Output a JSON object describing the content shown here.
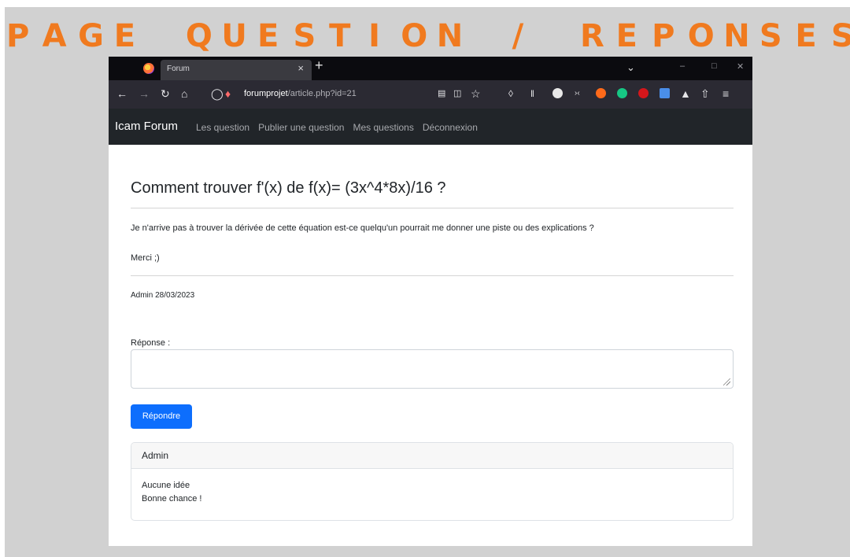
{
  "banner": {
    "letters": [
      "P",
      "A",
      "G",
      "E",
      "",
      "Q",
      "U",
      "E",
      "S",
      "T",
      "I",
      "O",
      "N",
      "",
      "/",
      "",
      "R",
      "E",
      "P",
      "O",
      "N",
      "S",
      "E",
      "S"
    ]
  },
  "browser": {
    "tab_title": "Forum",
    "tab_close": "×",
    "new_tab": "+",
    "url_host": "forumprojet",
    "url_path": "/article.php?id=21",
    "icons": {
      "back": "back-arrow-icon",
      "forward": "forward-arrow-icon",
      "reload": "reload-icon",
      "home": "home-icon",
      "shield": "tracking-shield-icon",
      "lock": "insecure-lock-icon",
      "reader": "reader-view-icon",
      "translate": "translate-icon",
      "bookmark": "bookmark-star-icon",
      "pocket": "pocket-icon",
      "library": "library-icon",
      "menu": "hamburger-menu-icon"
    }
  },
  "navbar": {
    "brand": "Icam Forum",
    "links": [
      "Les question",
      "Publier une question",
      "Mes questions",
      "Déconnexion"
    ]
  },
  "question": {
    "title": "Comment trouver f'(x) de f(x)= (3x^4*8x)/16 ?",
    "body": "Je n'arrive pas à trouver la dérivée de cette équation est-ce quelqu'un pourrait me donner une piste ou des explications ?",
    "thanks": "Merci ;)",
    "meta": "Admin 28/03/2023"
  },
  "reply_form": {
    "label": "Réponse :",
    "value": "",
    "button": "Répondre"
  },
  "answers": [
    {
      "author": "Admin",
      "lines": [
        "Aucune idée",
        "Bonne chance !"
      ]
    }
  ],
  "colors": {
    "banner": "#f07a1f",
    "navbar": "#212529",
    "primary_button": "#0d6efd",
    "background": "#d1d1d1"
  }
}
